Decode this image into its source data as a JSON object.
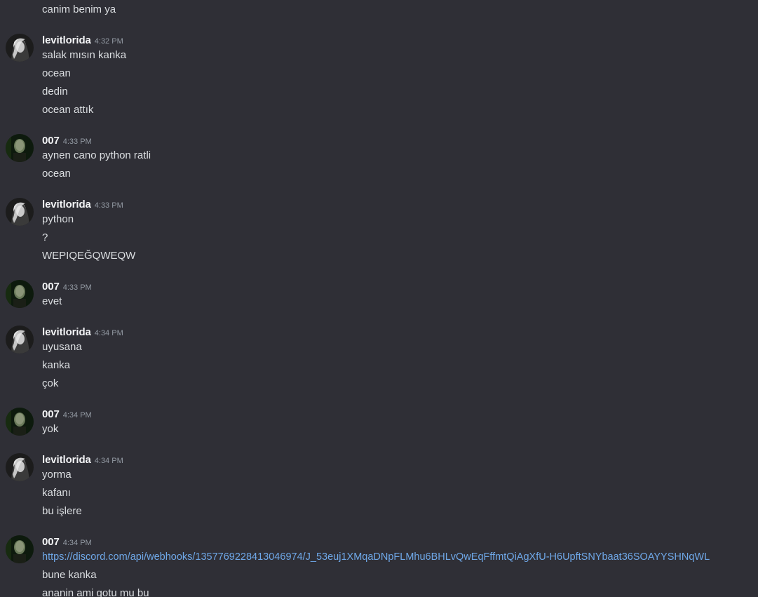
{
  "orphan_line": "canim benim ya",
  "groups": [
    {
      "author": "levitlorida",
      "time": "4:32 PM",
      "avatar": "levitlorida-avatar",
      "lines": [
        "salak mısın kanka",
        "ocean",
        "dedin",
        "ocean attık"
      ]
    },
    {
      "author": "007",
      "time": "4:33 PM",
      "avatar": "007-avatar",
      "lines": [
        "aynen cano python ratli",
        "ocean"
      ]
    },
    {
      "author": "levitlorida",
      "time": "4:33 PM",
      "avatar": "levitlorida-avatar",
      "lines": [
        "python",
        "?",
        "WEPIQEĞQWEQW"
      ]
    },
    {
      "author": "007",
      "time": "4:33 PM",
      "avatar": "007-avatar",
      "lines": [
        "evet"
      ]
    },
    {
      "author": "levitlorida",
      "time": "4:34 PM",
      "avatar": "levitlorida-avatar",
      "lines": [
        "uyusana",
        "kanka",
        "çok"
      ]
    },
    {
      "author": "007",
      "time": "4:34 PM",
      "avatar": "007-avatar",
      "lines": [
        "yok"
      ]
    },
    {
      "author": "levitlorida",
      "time": "4:34 PM",
      "avatar": "levitlorida-avatar",
      "lines": [
        "yorma",
        "kafanı",
        "bu işlere"
      ]
    },
    {
      "author": "007",
      "time": "4:34 PM",
      "avatar": "007-avatar",
      "lines": [
        "https://discord.com/api/webhooks/1357769228413046974/J_53euj1XMqaDNpFLMhu6BHLvQwEqFffmtQiAgXfU-H6UpftSNYbaat36SOAYYSHNqWL",
        "bune kanka",
        "ananin ami gotu mu bu"
      ]
    }
  ],
  "colors": {
    "background": "#2f2f36",
    "text": "#dbdee1",
    "username": "#f2f3f5",
    "timestamp": "#949ba4",
    "link": "#6fa8e8"
  }
}
